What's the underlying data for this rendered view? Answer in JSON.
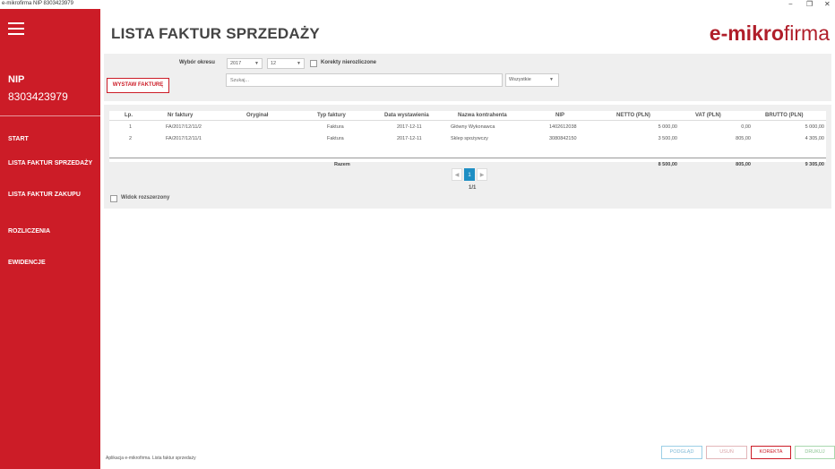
{
  "window": {
    "title": "e-mikrofirma NIP 8303423979",
    "minimize": "−",
    "maximize": "❐",
    "close": "✕"
  },
  "sidebar": {
    "nip_label": "NIP",
    "nip_value": "8303423979",
    "items": [
      {
        "label": "START"
      },
      {
        "label": "LISTA FAKTUR SPRZEDAŻY"
      },
      {
        "label": "LISTA FAKTUR ZAKUPU"
      },
      {
        "label": "ROZLICZENIA"
      },
      {
        "label": "EWIDENCJE"
      }
    ]
  },
  "header": {
    "title": "LISTA FAKTUR SPRZEDAŻY",
    "brand_bold": "e-mikro",
    "brand_light": "firma"
  },
  "filters": {
    "issue_button": "WYSTAW FAKTURĘ",
    "period_label": "Wybór okresu",
    "year": "2017",
    "month": "12",
    "corrections_label": "Korekty nierozliczone",
    "search_placeholder": "Szukaj...",
    "type_filter": "Wszystkie"
  },
  "table": {
    "columns": [
      "Lp.",
      "Nr faktury",
      "Oryginał",
      "Typ faktury",
      "Data wystawienia",
      "Nazwa kontrahenta",
      "NIP",
      "NETTO (PLN)",
      "VAT (PLN)",
      "BRUTTO (PLN)"
    ],
    "rows": [
      {
        "lp": "1",
        "nr": "FA/2017/12/11/2",
        "oryginal": "",
        "typ": "Faktura",
        "data": "2017-12-11",
        "kontrahent": "Główny Wykonawca",
        "nip": "1402612038",
        "netto": "5 000,00",
        "vat": "0,00",
        "brutto": "5 000,00"
      },
      {
        "lp": "2",
        "nr": "FA/2017/12/11/1",
        "oryginal": "",
        "typ": "Faktura",
        "data": "2017-12-11",
        "kontrahent": "Sklep spożywczy",
        "nip": "3080842150",
        "netto": "3 500,00",
        "vat": "805,00",
        "brutto": "4 305,00"
      }
    ],
    "total_label": "Razem",
    "total_netto": "8 500,00",
    "total_vat": "805,00",
    "total_brutto": "9 305,00"
  },
  "pagination": {
    "prev": "◀",
    "current": "1",
    "next": "▶",
    "count": "1/1"
  },
  "extended_view_label": "Widok rozszerzony",
  "status_text": "Aplikacja e-mikrofirma. Lista faktur sprzedaży",
  "actions": {
    "preview": "PODGLĄD",
    "delete": "USUŃ",
    "correction": "KOREKTA",
    "print": "DRUKUJ"
  },
  "colors": {
    "sidebar": "#cc1c27",
    "brand": "#b01e2a",
    "accent_blue": "#1f8fc4"
  }
}
